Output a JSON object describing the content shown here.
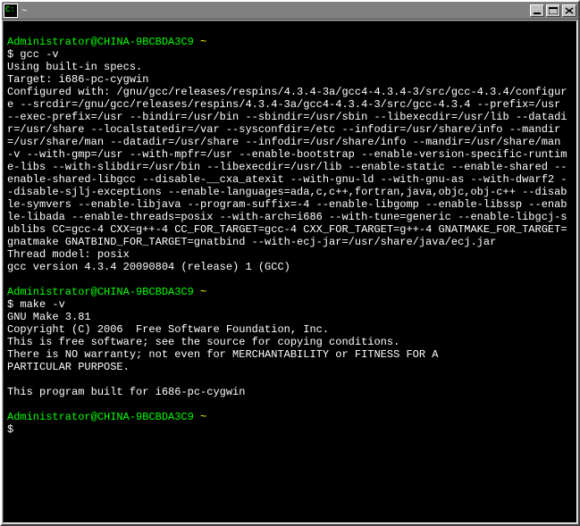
{
  "titlebar": {
    "title": "~",
    "icon_label": "C:"
  },
  "prompts": [
    {
      "user_host": "Administrator@CHINA-9BCBDA3C9",
      "path": "~",
      "command": "gcc -v"
    },
    {
      "user_host": "Administrator@CHINA-9BCBDA3C9",
      "path": "~",
      "command": "make -v"
    },
    {
      "user_host": "Administrator@CHINA-9BCBDA3C9",
      "path": "~",
      "command": ""
    }
  ],
  "gcc_output": {
    "line1": "Using built-in specs.",
    "line2": "Target: i686-pc-cygwin",
    "configured": "Configured with: /gnu/gcc/releases/respins/4.3.4-3a/gcc4-4.3.4-3/src/gcc-4.3.4/configure --srcdir=/gnu/gcc/releases/respins/4.3.4-3a/gcc4-4.3.4-3/src/gcc-4.3.4 --prefix=/usr --exec-prefix=/usr --bindir=/usr/bin --sbindir=/usr/sbin --libexecdir=/usr/lib --datadir=/usr/share --localstatedir=/var --sysconfdir=/etc --infodir=/usr/share/info --mandir=/usr/share/man --datadir=/usr/share --infodir=/usr/share/info --mandir=/usr/share/man -v --with-gmp=/usr --with-mpfr=/usr --enable-bootstrap --enable-version-specific-runtime-libs --with-slibdir=/usr/bin --libexecdir=/usr/lib --enable-static --enable-shared --enable-shared-libgcc --disable-__cxa_atexit --with-gnu-ld --with-gnu-as --with-dwarf2 --disable-sjlj-exceptions --enable-languages=ada,c,c++,fortran,java,objc,obj-c++ --disable-symvers --enable-libjava --program-suffix=-4 --enable-libgomp --enable-libssp --enable-libada --enable-threads=posix --with-arch=i686 --with-tune=generic --enable-libgcj-sublibs CC=gcc-4 CXX=g++-4 CC_FOR_TARGET=gcc-4 CXX_FOR_TARGET=g++-4 GNATMAKE_FOR_TARGET=gnatmake GNATBIND_FOR_TARGET=gnatbind --with-ecj-jar=/usr/share/java/ecj.jar",
    "thread_model": "Thread model: posix",
    "version": "gcc version 4.3.4 20090804 (release) 1 (GCC)"
  },
  "make_output": {
    "line1": "GNU Make 3.81",
    "line2": "Copyright (C) 2006  Free Software Foundation, Inc.",
    "line3": "This is free software; see the source for copying conditions.",
    "line4": "There is NO warranty; not even for MERCHANTABILITY or FITNESS FOR A",
    "line5": "PARTICULAR PURPOSE.",
    "line6": "This program built for i686-pc-cygwin"
  }
}
